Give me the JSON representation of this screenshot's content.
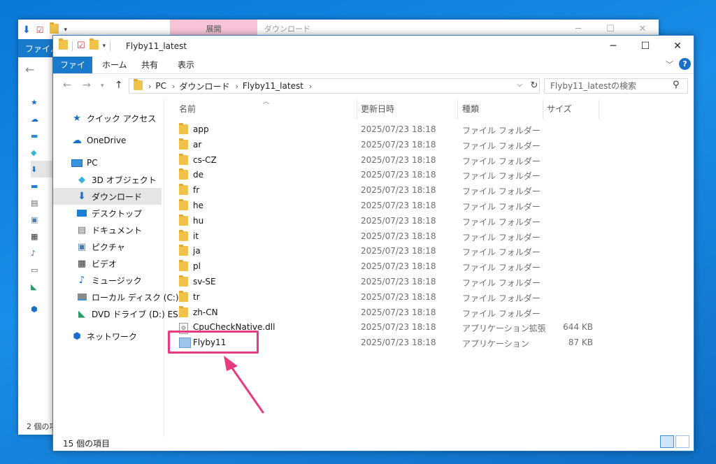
{
  "background_window": {
    "ribbon_tab": "ファイル",
    "context_tab": "展開",
    "title": "ダウンロード",
    "status": "2 個の項"
  },
  "window": {
    "title": "Flyby11_latest",
    "controls": {
      "minimize": "─",
      "maximize": "☐",
      "close": "✕"
    }
  },
  "ribbon": {
    "tabs": [
      "ファイル",
      "ホーム",
      "共有",
      "表示"
    ]
  },
  "address": {
    "crumbs": [
      "PC",
      "ダウンロード",
      "Flyby11_latest"
    ],
    "search_placeholder": "Flyby11_latestの検索"
  },
  "nav_pane": {
    "items": [
      {
        "label": "クイック アクセス",
        "icon": "star-icon"
      },
      {
        "label": "OneDrive",
        "icon": "cloud-icon"
      },
      {
        "label": "PC",
        "icon": "pc-icon"
      },
      {
        "label": "3D オブジェクト",
        "icon": "cube-icon"
      },
      {
        "label": "ダウンロード",
        "icon": "download-icon",
        "selected": true
      },
      {
        "label": "デスクトップ",
        "icon": "desktop-icon"
      },
      {
        "label": "ドキュメント",
        "icon": "document-icon"
      },
      {
        "label": "ピクチャ",
        "icon": "picture-icon"
      },
      {
        "label": "ビデオ",
        "icon": "video-icon"
      },
      {
        "label": "ミュージック",
        "icon": "music-icon"
      },
      {
        "label": "ローカル ディスク (C:)",
        "icon": "drive-icon"
      },
      {
        "label": "DVD ドライブ (D:) ESI",
        "icon": "dvd-icon"
      },
      {
        "label": "ネットワーク",
        "icon": "network-icon"
      }
    ]
  },
  "columns": {
    "name": "名前",
    "date": "更新日時",
    "type": "種類",
    "size": "サイズ"
  },
  "files": [
    {
      "name": "app",
      "date": "2025/07/23 18:18",
      "type": "ファイル フォルダー",
      "size": "",
      "icon": "folder-icon"
    },
    {
      "name": "ar",
      "date": "2025/07/23 18:18",
      "type": "ファイル フォルダー",
      "size": "",
      "icon": "folder-icon"
    },
    {
      "name": "cs-CZ",
      "date": "2025/07/23 18:18",
      "type": "ファイル フォルダー",
      "size": "",
      "icon": "folder-icon"
    },
    {
      "name": "de",
      "date": "2025/07/23 18:18",
      "type": "ファイル フォルダー",
      "size": "",
      "icon": "folder-icon"
    },
    {
      "name": "fr",
      "date": "2025/07/23 18:18",
      "type": "ファイル フォルダー",
      "size": "",
      "icon": "folder-icon"
    },
    {
      "name": "he",
      "date": "2025/07/23 18:18",
      "type": "ファイル フォルダー",
      "size": "",
      "icon": "folder-icon"
    },
    {
      "name": "hu",
      "date": "2025/07/23 18:18",
      "type": "ファイル フォルダー",
      "size": "",
      "icon": "folder-icon"
    },
    {
      "name": "it",
      "date": "2025/07/23 18:18",
      "type": "ファイル フォルダー",
      "size": "",
      "icon": "folder-icon"
    },
    {
      "name": "ja",
      "date": "2025/07/23 18:18",
      "type": "ファイル フォルダー",
      "size": "",
      "icon": "folder-icon"
    },
    {
      "name": "pl",
      "date": "2025/07/23 18:18",
      "type": "ファイル フォルダー",
      "size": "",
      "icon": "folder-icon"
    },
    {
      "name": "sv-SE",
      "date": "2025/07/23 18:18",
      "type": "ファイル フォルダー",
      "size": "",
      "icon": "folder-icon"
    },
    {
      "name": "tr",
      "date": "2025/07/23 18:18",
      "type": "ファイル フォルダー",
      "size": "",
      "icon": "folder-icon"
    },
    {
      "name": "zh-CN",
      "date": "2025/07/23 18:18",
      "type": "ファイル フォルダー",
      "size": "",
      "icon": "folder-icon"
    },
    {
      "name": "CpuCheckNative.dll",
      "date": "2025/07/23 18:18",
      "type": "アプリケーション拡張",
      "size": "644 KB",
      "icon": "dll-icon"
    },
    {
      "name": "Flyby11",
      "date": "2025/07/23 18:18",
      "type": "アプリケーション",
      "size": "87 KB",
      "icon": "app-icon"
    }
  ],
  "status": {
    "count": "15 個の項目"
  },
  "annotation_color": "#e83a7f"
}
